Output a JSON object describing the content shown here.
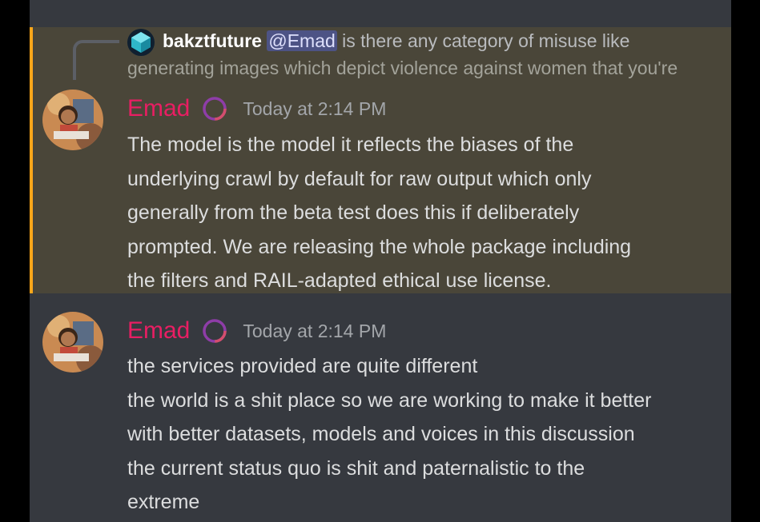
{
  "reply": {
    "username": "bakztfuture",
    "mention": "@Emad",
    "text_line1": " is there any category of misuse like",
    "text_line2": "generating images which depict violence against women that you're"
  },
  "messages": [
    {
      "author": "Emad",
      "timestamp": "Today at 2:14 PM",
      "lines": [
        "The model is the model it reflects the biases of the",
        "underlying crawl by default for raw output which only",
        "generally from the beta test does this if deliberately",
        "prompted. We are releasing the whole package including",
        "the filters and RAIL-adapted ethical use license."
      ]
    },
    {
      "author": "Emad",
      "timestamp": "Today at 2:14 PM",
      "lines": [
        "the services provided are quite different",
        "the world is a shit place so we are working to make it better",
        "with better datasets, models and voices in this discussion",
        "the current status quo is shit and paternalistic to the",
        "extreme"
      ]
    }
  ],
  "colors": {
    "author": "#e91e63",
    "mention_highlight": "#faa61a",
    "background": "#36393f"
  }
}
